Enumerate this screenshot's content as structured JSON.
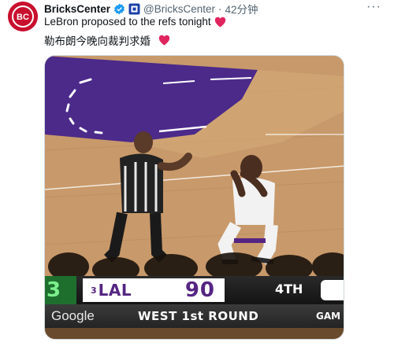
{
  "tweet": {
    "author_name": "BricksCenter",
    "handle": "@BricksCenter",
    "separator": "·",
    "timestamp": "42分钟",
    "text_line1": "LeBron proposed to the refs tonight",
    "text_line2": "勒布朗今晚向裁判求婚",
    "more_label": "···"
  },
  "icons": {
    "avatar": "bricks-center-logo-icon",
    "verified": "verified-check-icon",
    "org": "affiliate-badge-icon",
    "heart": "red-heart-emoji-icon"
  },
  "scoreboard": {
    "away_score_partial": "3",
    "home_seed": "3",
    "home_team": "LAL",
    "home_score": "90",
    "period": "4TH",
    "sponsor": "Google",
    "round": "WEST 1st ROUND",
    "round_tail": "GAM"
  },
  "colors": {
    "avatar_bg": "#c8102e",
    "verified_blue": "#1d9bf0",
    "heart_red": "#e0245e",
    "lakers_purple": "#552583",
    "court_wood": "#c59764",
    "paint_purple": "#4b2a8a"
  }
}
